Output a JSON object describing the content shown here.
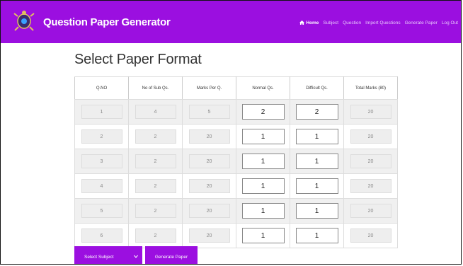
{
  "navbar": {
    "brand": "Question Paper Generator",
    "links": [
      "Home",
      "Subject",
      "Question",
      "Import Questions",
      "Generate Paper",
      "Log Out"
    ],
    "active": "Home"
  },
  "page": {
    "title": "Select Paper Format"
  },
  "table": {
    "headers": [
      "Q.NO",
      "No of Sub Qs.",
      "Marks Per Q.",
      "Normal Qs.",
      "Difficult Qs.",
      "Total Marks (80)"
    ],
    "rows": [
      {
        "qno": "1",
        "sub": "4",
        "marks": "5",
        "normal": "2",
        "difficult": "2",
        "total": "20"
      },
      {
        "qno": "2",
        "sub": "2",
        "marks": "20",
        "normal": "1",
        "difficult": "1",
        "total": "20"
      },
      {
        "qno": "3",
        "sub": "2",
        "marks": "20",
        "normal": "1",
        "difficult": "1",
        "total": "20"
      },
      {
        "qno": "4",
        "sub": "2",
        "marks": "20",
        "normal": "1",
        "difficult": "1",
        "total": "20"
      },
      {
        "qno": "5",
        "sub": "2",
        "marks": "20",
        "normal": "1",
        "difficult": "1",
        "total": "20"
      },
      {
        "qno": "6",
        "sub": "2",
        "marks": "20",
        "normal": "1",
        "difficult": "1",
        "total": "20"
      }
    ]
  },
  "actions": {
    "select_subject": "Select Subject",
    "generate_paper": "Generate Paper"
  },
  "colors": {
    "accent": "#9b0fe0"
  },
  "icons": {
    "logo": "turtle-logo-icon",
    "home": "home-icon",
    "dropdown": "chevron-down-icon"
  }
}
